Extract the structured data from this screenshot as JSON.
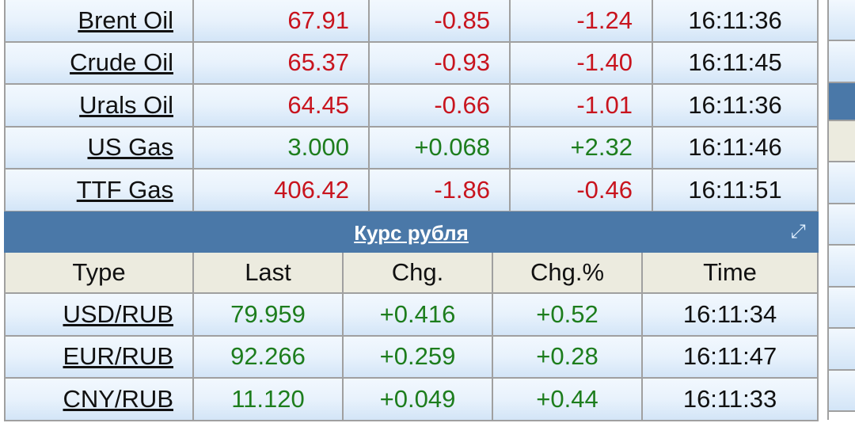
{
  "commodities": [
    {
      "name": "Brent Oil",
      "last": "67.91",
      "chg": "-0.85",
      "chg_pct": "-1.24",
      "time": "16:11:36",
      "dir": "down"
    },
    {
      "name": "Crude Oil",
      "last": "65.37",
      "chg": "-0.93",
      "chg_pct": "-1.40",
      "time": "16:11:45",
      "dir": "down"
    },
    {
      "name": "Urals Oil",
      "last": "64.45",
      "chg": "-0.66",
      "chg_pct": "-1.01",
      "time": "16:11:36",
      "dir": "down"
    },
    {
      "name": "US Gas",
      "last": "3.000",
      "chg": "+0.068",
      "chg_pct": "+2.32",
      "time": "16:11:46",
      "dir": "up"
    },
    {
      "name": "TTF Gas",
      "last": "406.42",
      "chg": "-1.86",
      "chg_pct": "-0.46",
      "time": "16:11:51",
      "dir": "down"
    }
  ],
  "ruble": {
    "title": "Курс рубля",
    "headers": [
      "Type",
      "Last",
      "Chg.",
      "Chg.%",
      "Time"
    ],
    "rows": [
      {
        "name": "USD/RUB",
        "last": "79.959",
        "chg": "+0.416",
        "chg_pct": "+0.52",
        "time": "16:11:34",
        "dir": "up"
      },
      {
        "name": "EUR/RUB",
        "last": "92.266",
        "chg": "+0.259",
        "chg_pct": "+0.28",
        "time": "16:11:47",
        "dir": "up"
      },
      {
        "name": "CNY/RUB",
        "last": "11.120",
        "chg": "+0.049",
        "chg_pct": "+0.44",
        "time": "16:11:33",
        "dir": "up"
      }
    ]
  },
  "colors": {
    "up": "#1d7d1d",
    "down": "#c8141e",
    "banner": "#4a78a8",
    "header": "#ecebdf"
  }
}
